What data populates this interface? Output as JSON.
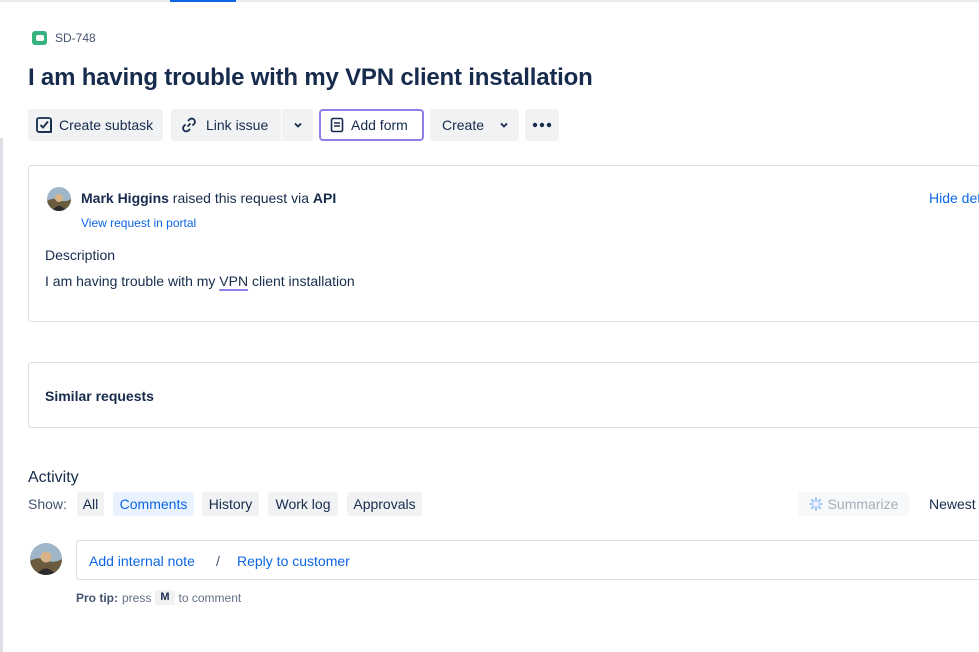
{
  "issue": {
    "key": "SD-748",
    "title": "I am having trouble with my VPN client installation"
  },
  "toolbar": {
    "create_subtask": "Create subtask",
    "link_issue": "Link issue",
    "add_form": "Add form",
    "create": "Create"
  },
  "request": {
    "reporter": "Mark Higgins",
    "raised_text": "raised this request via",
    "channel": "API",
    "view_portal": "View request in portal",
    "hide_details": "Hide details",
    "description_label": "Description",
    "description_before": "I am having trouble with my ",
    "description_highlight": "VPN",
    "description_after": " client installation"
  },
  "similar": {
    "title": "Similar requests"
  },
  "activity": {
    "title": "Activity",
    "show_label": "Show:",
    "filters": {
      "all": "All",
      "comments": "Comments",
      "history": "History",
      "work_log": "Work log",
      "approvals": "Approvals"
    },
    "selected_filter": "comments",
    "summarize": "Summarize",
    "sort": "Newest first"
  },
  "comment": {
    "add_internal_note": "Add internal note",
    "separator": "/",
    "reply_to_customer": "Reply to customer",
    "protip_label": "Pro tip:",
    "protip_press": "press",
    "protip_key": "M",
    "protip_suffix": "to comment"
  },
  "colors": {
    "link": "#0c66e4",
    "text": "#172b4d",
    "form_border": "#8f7ee7",
    "issue_icon": "#36b37e"
  },
  "icons": {
    "issue_type": "service-request-icon",
    "subtask": "subtask-icon",
    "link": "link-icon",
    "form": "form-icon",
    "more": "more-icon",
    "summarize": "sparkle-icon"
  }
}
